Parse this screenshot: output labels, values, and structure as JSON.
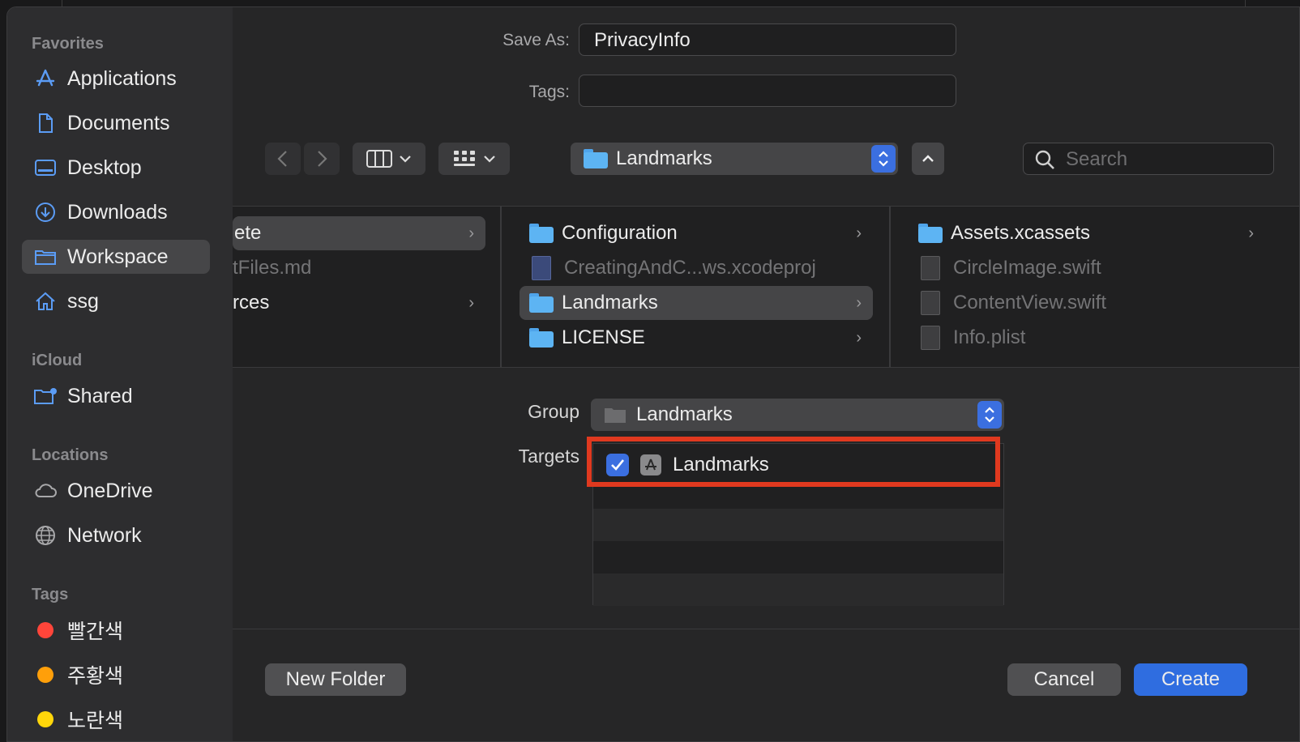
{
  "sidebar": {
    "favorites_header": "Favorites",
    "favorites": [
      {
        "label": "Applications",
        "icon": "app-store-icon"
      },
      {
        "label": "Documents",
        "icon": "document-icon"
      },
      {
        "label": "Desktop",
        "icon": "desktop-icon"
      },
      {
        "label": "Downloads",
        "icon": "download-icon"
      },
      {
        "label": "Workspace",
        "icon": "folder-icon",
        "selected": true
      },
      {
        "label": "ssg",
        "icon": "home-icon"
      }
    ],
    "icloud_header": "iCloud",
    "icloud": [
      {
        "label": "Shared",
        "icon": "shared-folder-icon"
      }
    ],
    "locations_header": "Locations",
    "locations": [
      {
        "label": "OneDrive",
        "icon": "cloud-icon"
      },
      {
        "label": "Network",
        "icon": "globe-icon"
      }
    ],
    "tags_header": "Tags",
    "tags": [
      {
        "label": "빨간색",
        "color": "#ff453a"
      },
      {
        "label": "주황색",
        "color": "#ff9f0a"
      },
      {
        "label": "노란색",
        "color": "#ffd60a"
      }
    ]
  },
  "save_as": {
    "label": "Save As:",
    "value": "PrivacyInfo"
  },
  "tags_field": {
    "label": "Tags:",
    "value": ""
  },
  "location_popup": {
    "value": "Landmarks"
  },
  "search": {
    "placeholder": "Search"
  },
  "browser": {
    "col1": [
      {
        "name": "ete",
        "chevron": true,
        "selected": true,
        "dim": false
      },
      {
        "name": "tFiles.md",
        "chevron": false,
        "selected": false,
        "dim": true
      },
      {
        "name": "rces",
        "chevron": true,
        "selected": false,
        "dim": false
      }
    ],
    "col2": [
      {
        "name": "Configuration",
        "kind": "folder",
        "chevron": true,
        "dim": false
      },
      {
        "name": "CreatingAndC...ws.xcodeproj",
        "kind": "xcodeproj",
        "chevron": false,
        "dim": true
      },
      {
        "name": "Landmarks",
        "kind": "folder",
        "chevron": true,
        "dim": false,
        "selected": true
      },
      {
        "name": "LICENSE",
        "kind": "folder",
        "chevron": true,
        "dim": false
      }
    ],
    "col3": [
      {
        "name": "Assets.xcassets",
        "kind": "folder",
        "chevron": true,
        "dim": false
      },
      {
        "name": "CircleImage.swift",
        "kind": "swift",
        "chevron": false,
        "dim": true
      },
      {
        "name": "ContentView.swift",
        "kind": "swift",
        "chevron": false,
        "dim": true
      },
      {
        "name": "Info.plist",
        "kind": "plist",
        "chevron": false,
        "dim": true
      }
    ]
  },
  "group": {
    "label": "Group",
    "value": "Landmarks"
  },
  "targets": {
    "label": "Targets",
    "items": [
      {
        "name": "Landmarks",
        "checked": true
      }
    ]
  },
  "buttons": {
    "new_folder": "New Folder",
    "cancel": "Cancel",
    "create": "Create"
  },
  "colors": {
    "accent": "#3b6fe0",
    "highlight": "#e0391f"
  }
}
